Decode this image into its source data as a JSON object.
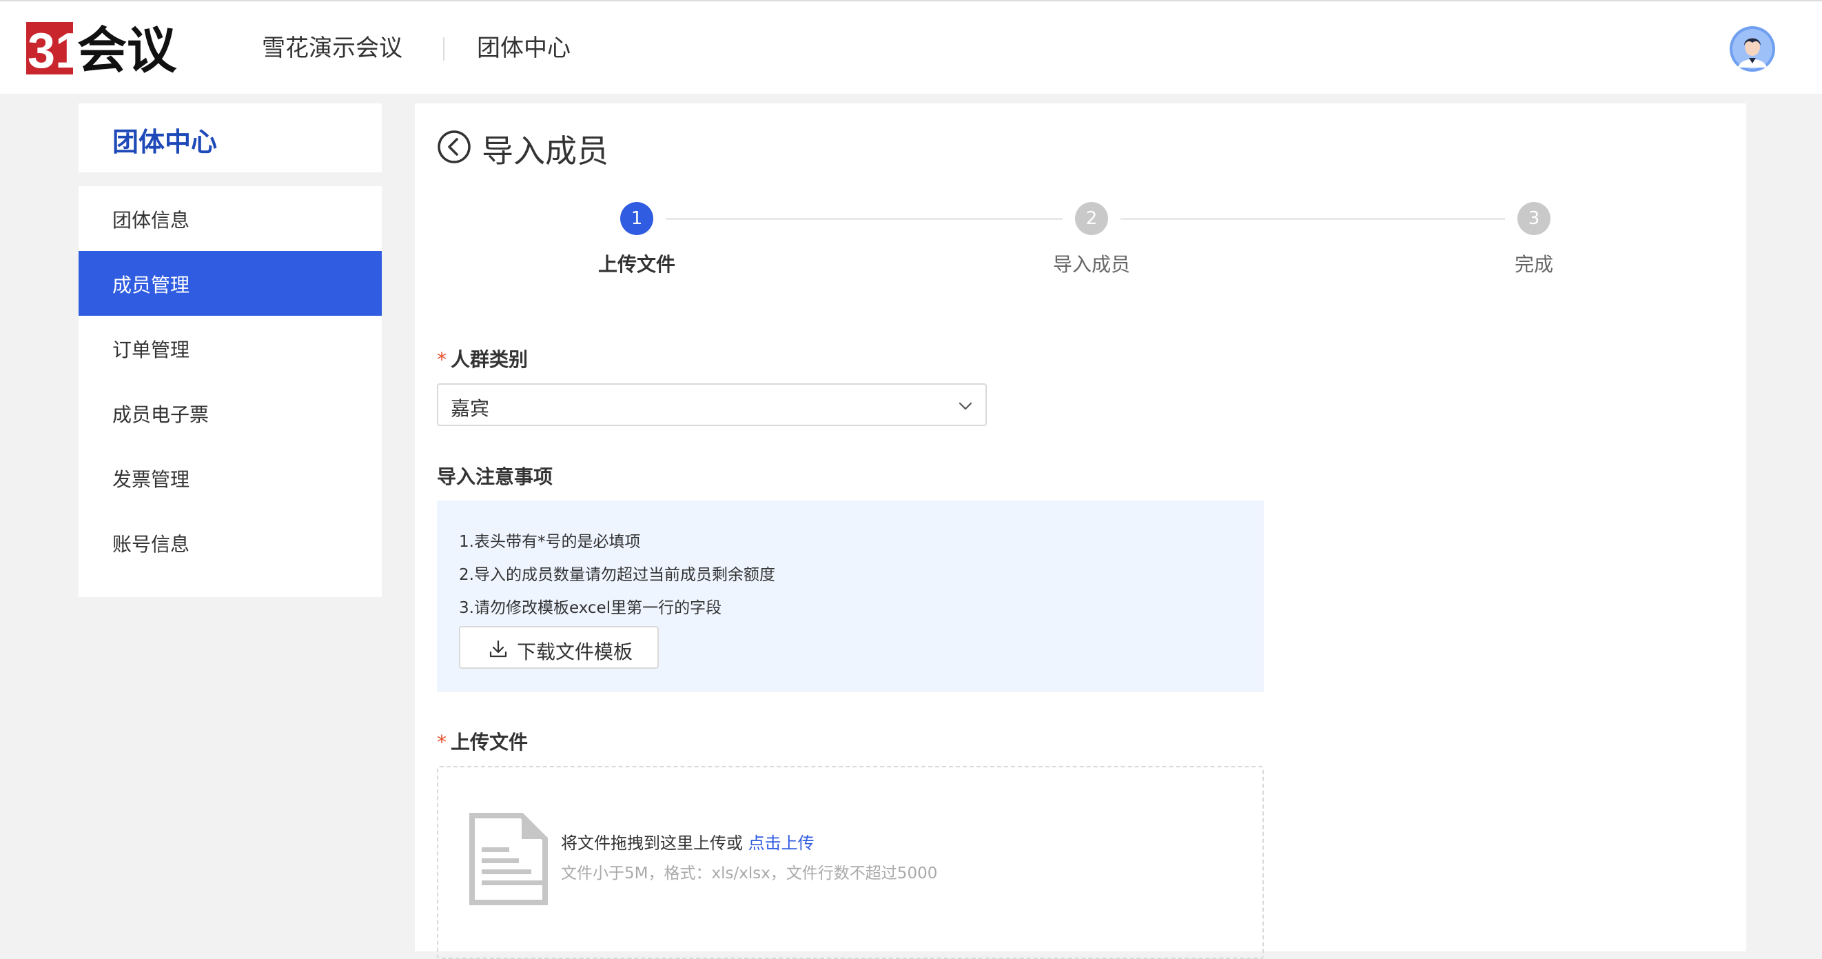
{
  "header": {
    "logo_text": "31会议",
    "nav": [
      "雪花演示会议",
      "团体中心"
    ],
    "avatar_icon": "user-avatar-icon"
  },
  "sidebar": {
    "title": "团体中心",
    "items": [
      {
        "label": "团体信息",
        "active": false
      },
      {
        "label": "成员管理",
        "active": true
      },
      {
        "label": "订单管理",
        "active": false
      },
      {
        "label": "成员电子票",
        "active": false
      },
      {
        "label": "发票管理",
        "active": false
      },
      {
        "label": "账号信息",
        "active": false
      }
    ]
  },
  "main": {
    "title": "导入成员",
    "steps": [
      {
        "num": "1",
        "label": "上传文件",
        "state": "current"
      },
      {
        "num": "2",
        "label": "导入成员",
        "state": "todo"
      },
      {
        "num": "3",
        "label": "完成",
        "state": "todo"
      }
    ],
    "category": {
      "required_mark": "*",
      "label": "人群类别",
      "value": "嘉宾"
    },
    "notice": {
      "title": "导入注意事项",
      "lines": [
        "1.表头带有*号的是必填项",
        "2.导入的成员数量请勿超过当前成员剩余额度",
        "3.请勿修改模板excel里第一行的字段"
      ],
      "download_label": "下载文件模板"
    },
    "upload": {
      "required_mark": "*",
      "label": "上传文件",
      "drag_text": "将文件拖拽到这里上传或",
      "click_text": "点击上传",
      "hint": "文件小于5M，格式：xls/xlsx，文件行数不超过5000"
    }
  },
  "colors": {
    "primary": "#2f5ce0",
    "brand_red": "#c8252c",
    "required": "#e8522f",
    "notice_bg": "#eff5ff"
  }
}
